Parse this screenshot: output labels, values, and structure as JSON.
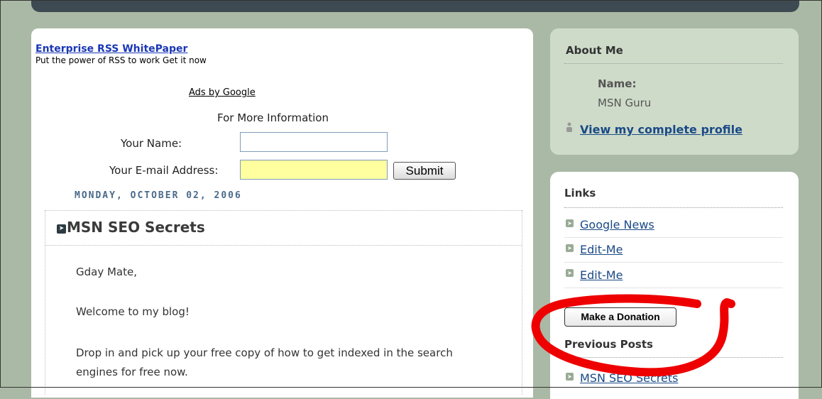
{
  "ad": {
    "link_text": "Enterprise RSS WhitePaper",
    "tagline": "Put the power of RSS to work Get it now",
    "ads_by": "Ads by Google"
  },
  "form": {
    "heading": "For More Information",
    "name_label": "Your Name:",
    "name_value": "",
    "email_label": "Your E-mail Address:",
    "email_value": "",
    "submit_label": "Submit"
  },
  "post": {
    "date": "MONDAY, OCTOBER 02, 2006",
    "title": "MSN SEO Secrets",
    "paragraphs": [
      "Gday Mate,",
      "Welcome to my blog!",
      "Drop in and pick up your free copy of how to get indexed in the search",
      "engines for free now."
    ]
  },
  "about": {
    "heading": "About Me",
    "name_label": "Name:",
    "name_value": "MSN Guru",
    "profile_link": "View my complete profile"
  },
  "links": {
    "heading": "Links",
    "items": [
      "Google News",
      "Edit-Me",
      "Edit-Me"
    ]
  },
  "donate_label": "Make a Donation",
  "previous_posts": {
    "heading": "Previous Posts",
    "items": [
      "MSN SEO Secrets"
    ]
  },
  "colors": {
    "background": "#aab9a5",
    "link": "#1a4a86",
    "annotation": "#ee0000"
  }
}
